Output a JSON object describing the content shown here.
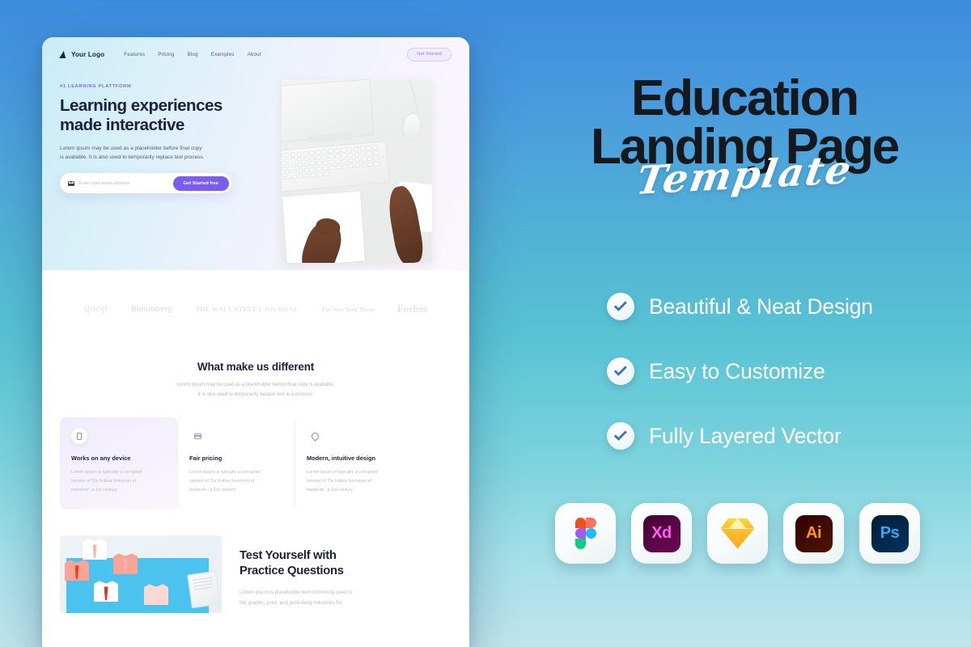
{
  "background": {
    "top_color": "#3e8bdd",
    "mid_color": "#55c0d4",
    "bottom_color": "#c0e5ec"
  },
  "mockup": {
    "nav": {
      "logo_text": "Your Logo",
      "links": [
        "Features",
        "Pricing",
        "Blog",
        "Examples",
        "About"
      ],
      "cta_label": "Get Started"
    },
    "hero": {
      "eyebrow": "#1 LEARNING PLATTFORM",
      "heading_line1": "Learning experiences",
      "heading_line2": "made interactive",
      "paragraph_line1": "Lorem ipsum may be used as a placeholder before final copy",
      "paragraph_line2": "is available. It is also used to temporarily replace text process.",
      "email_placeholder": "Enter your email address",
      "email_value": "",
      "form_button": "Get Started free",
      "mail_icon": "envelope-icon",
      "photo_alt": "desk-with-keyboard-mouse-and-hands-writing"
    },
    "brands": [
      "goop",
      "Bloomberg",
      "THE WALL STREET JOURNAL",
      "The New York Times",
      "Forbes"
    ],
    "features": {
      "title": "What make us different",
      "subtitle_line1": "Lorem ipsum may be used as a placeholder before final copy is available.",
      "subtitle_line2": "It is also used to temporarily replace text in a process.",
      "cards": [
        {
          "icon": "mobile-device-icon",
          "title": "Works on any device",
          "desc_l1": "Lorem ipsum is typically a corrupted",
          "desc_l2": "version of 'De finibus bonorum et",
          "desc_l3": "malorum', a 1st century"
        },
        {
          "icon": "credit-card-icon",
          "title": "Fair pricing",
          "desc_l1": "Lorem ipsum is typically a corrupted",
          "desc_l2": "version of 'De finibus bonorum et",
          "desc_l3": "malorum', a 1st century"
        },
        {
          "icon": "pen-nib-icon",
          "title": "Modern, intuitive design",
          "desc_l1": "Lorem ipsum is typically a corrupted",
          "desc_l2": "version of 'De finibus bonorum et",
          "desc_l3": "malorum', a 1st century"
        }
      ]
    },
    "practice": {
      "heading_line1": "Test Yourself with",
      "heading_line2": "Practice Questions",
      "paragraph_line1": "Lorem ipsum is placeholder text commonly used in",
      "paragraph_line2": "the graphic, print, and publishing industries for",
      "photo_alt": "paper-shirts-with-ties-on-blue-background"
    }
  },
  "promo": {
    "title_line1": "Education",
    "title_line2": "Landing Page",
    "script_word": "Template",
    "title_color": "#15181c",
    "script_color": "#ffffff",
    "features": [
      {
        "icon": "check-circle-icon",
        "label": "Beautiful & Neat Design"
      },
      {
        "icon": "check-circle-icon",
        "label": "Easy to Customize"
      },
      {
        "icon": "check-circle-icon",
        "label": "Fully Layered Vector"
      }
    ],
    "tools": [
      {
        "name": "figma-icon",
        "label": ""
      },
      {
        "name": "adobe-xd-icon",
        "label": "Xd"
      },
      {
        "name": "sketch-icon",
        "label": ""
      },
      {
        "name": "illustrator-icon",
        "label": "Ai"
      },
      {
        "name": "photoshop-icon",
        "label": "Ps"
      }
    ]
  }
}
